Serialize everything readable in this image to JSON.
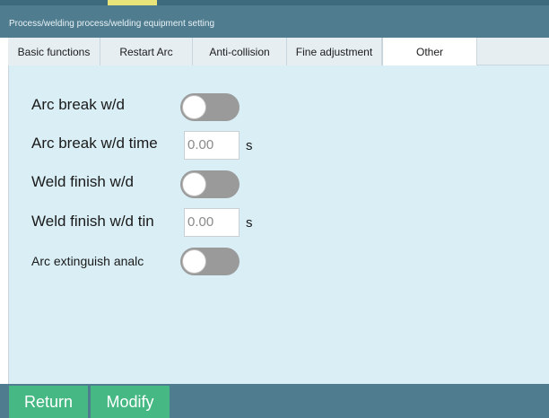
{
  "window": {
    "breadcrumb": "Process/welding process/welding equipment setting"
  },
  "tabs": [
    {
      "label": "Basic functions"
    },
    {
      "label": "Restart Arc"
    },
    {
      "label": "Anti-collision"
    },
    {
      "label": "Fine adjustment"
    },
    {
      "label": "Other",
      "active": true
    }
  ],
  "settings": {
    "arc_break_wd": {
      "label": "Arc break w/d",
      "state": "off"
    },
    "arc_break_wd_time": {
      "label": "Arc break w/d time",
      "value": "0.00",
      "unit": "s"
    },
    "weld_finish_wd": {
      "label": "Weld finish w/d",
      "state": "off"
    },
    "weld_finish_wd_time": {
      "label": "Weld finish w/d tin",
      "value": "0.00",
      "unit": "s"
    },
    "arc_extinguish_analog": {
      "label": "Arc extinguish analc",
      "state": "off"
    }
  },
  "footer": {
    "return_label": "Return",
    "modify_label": "Modify"
  },
  "colors": {
    "title_bar": "#4f7c8f",
    "panel_bg": "#d9eef5",
    "button_green": "#45b883",
    "toggle_off": "#9a9a9a"
  }
}
